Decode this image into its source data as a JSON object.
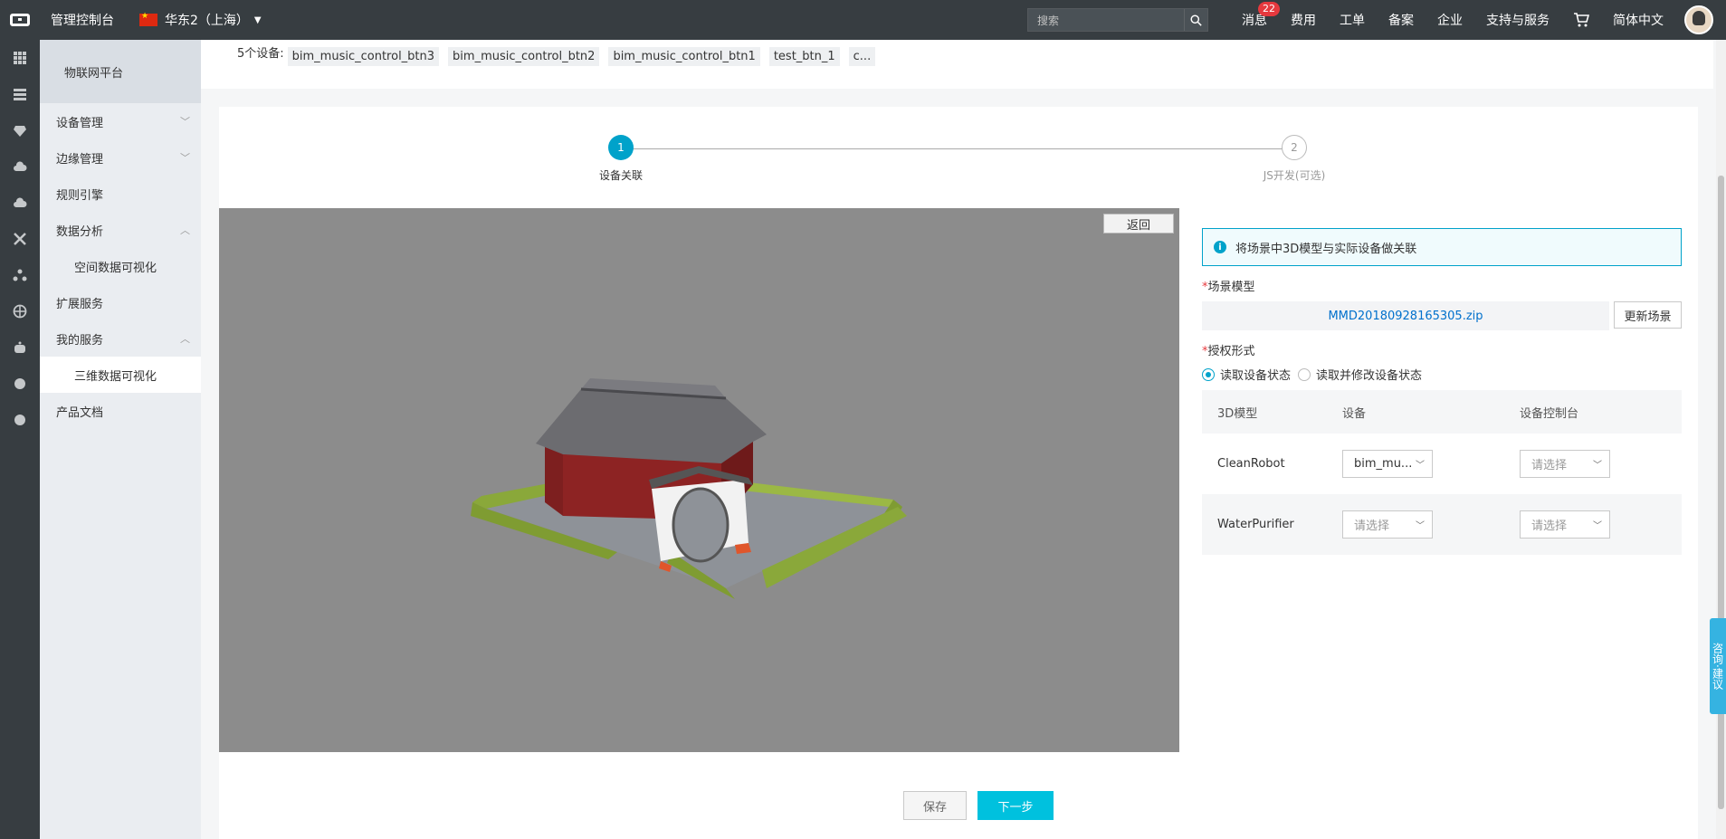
{
  "topbar": {
    "console_title": "管理控制台",
    "region": "华东2（上海）",
    "search_placeholder": "搜索",
    "messages_label": "消息",
    "messages_badge": "22",
    "nav": [
      "费用",
      "工单",
      "备案",
      "企业",
      "支持与服务"
    ],
    "language": "简体中文"
  },
  "iconbar": {
    "icons": [
      "apps-grid-icon",
      "server-icon",
      "diamond-icon",
      "cloud-upload-icon",
      "cloud-icon",
      "network-cross-icon",
      "nodes-icon",
      "globe-icon",
      "robot-icon",
      "dot-icon",
      "dot-icon"
    ]
  },
  "sidebar": {
    "header": "物联网平台",
    "items": [
      {
        "label": "设备管理",
        "chevron": "down",
        "sub": false
      },
      {
        "label": "边缘管理",
        "chevron": "down",
        "sub": false
      },
      {
        "label": "规则引擎",
        "chevron": "",
        "sub": false
      },
      {
        "label": "数据分析",
        "chevron": "up",
        "sub": false
      },
      {
        "label": "空间数据可视化",
        "chevron": "",
        "sub": true
      },
      {
        "label": "扩展服务",
        "chevron": "",
        "sub": false
      },
      {
        "label": "我的服务",
        "chevron": "up",
        "sub": false
      },
      {
        "label": "三维数据可视化",
        "chevron": "",
        "sub": true,
        "active": true
      },
      {
        "label": "产品文档",
        "chevron": "",
        "sub": false
      }
    ]
  },
  "devices": {
    "label": "5个设备:",
    "tags": [
      "bim_music_control_btn3",
      "bim_music_control_btn2",
      "bim_music_control_btn1",
      "test_btn_1",
      "c..."
    ]
  },
  "steps": {
    "step1_num": "1",
    "step1_label": "设备关联",
    "step2_num": "2",
    "step2_label": "JS开发(可选)"
  },
  "scene": {
    "back_label": "返回"
  },
  "config": {
    "info_text": "将场景中3D模型与实际设备做关联",
    "model_label": "场景模型",
    "file_name": "MMD20180928165305.zip",
    "update_label": "更新场景",
    "auth_label": "授权形式",
    "auth_option1": "读取设备状态",
    "auth_option2": "读取并修改设备状态",
    "table_headers": [
      "3D模型",
      "设备",
      "设备控制台"
    ],
    "rows": [
      {
        "model": "CleanRobot",
        "device": "bim_mu...",
        "console": "请选择"
      },
      {
        "model": "WaterPurifier",
        "device": "请选择",
        "console": "请选择"
      }
    ],
    "required_mark": "*"
  },
  "footer": {
    "save_label": "保存",
    "next_label": "下一步"
  },
  "consult": {
    "label": "咨询·建议"
  },
  "colors": {
    "topbar": "#373d41",
    "accent": "#00a2ca",
    "primary_button": "#00c1de"
  }
}
